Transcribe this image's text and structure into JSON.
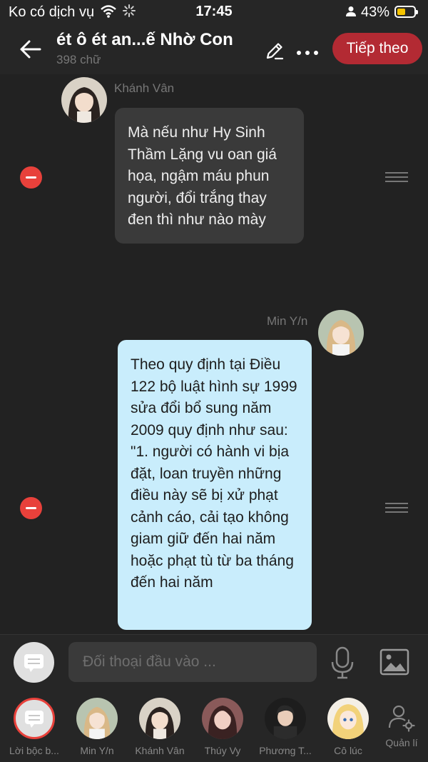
{
  "status_bar": {
    "carrier": "Ko có dịch vụ",
    "time": "17:45",
    "battery": "43%"
  },
  "header": {
    "title": "ét ô ét an...ế Nhờ Con",
    "word_count": "398 chữ",
    "next_button": "Tiếp theo"
  },
  "messages": [
    {
      "sender": "Khánh Vân",
      "side": "left",
      "text": "Mà nếu như Hy Sinh Thầm Lặng vu oan giá họa, ngậm máu phun người, đổi trắng thay đen thì như nào mày"
    },
    {
      "sender": "Min Y/n",
      "side": "right",
      "text": "Theo quy định tại Điều 122 bộ luật hình sự 1999 sửa đổi bổ sung năm 2009 quy định như sau: \"1. người có hành vi bịa đặt, loan truyền những điều này sẽ bị xử phạt cảnh cáo, cải tạo không giam giữ đến hai năm hoặc phạt tù từ ba tháng đến hai năm"
    }
  ],
  "input": {
    "placeholder": "Đối thoại đầu vào ..."
  },
  "characters": [
    {
      "name": "Lời bộc b..."
    },
    {
      "name": "Min Y/n"
    },
    {
      "name": "Khánh Vân"
    },
    {
      "name": "Thúy Vy"
    },
    {
      "name": "Phương T..."
    },
    {
      "name": "Cô lúc"
    }
  ],
  "manage_label": "Quản lí",
  "colors": {
    "accent": "#b32a33",
    "delete": "#e8413b",
    "bubble_dark": "#3a3a3a",
    "bubble_light": "#c9edfc",
    "background": "#222222"
  },
  "icons": [
    "wifi-icon",
    "loading-icon",
    "person-icon",
    "battery-icon",
    "back-arrow-icon",
    "pencil-icon",
    "more-dots-icon",
    "minus-icon",
    "drag-handle-icon",
    "chat-bubble-icon",
    "microphone-icon",
    "image-icon",
    "manage-person-gear-icon"
  ]
}
